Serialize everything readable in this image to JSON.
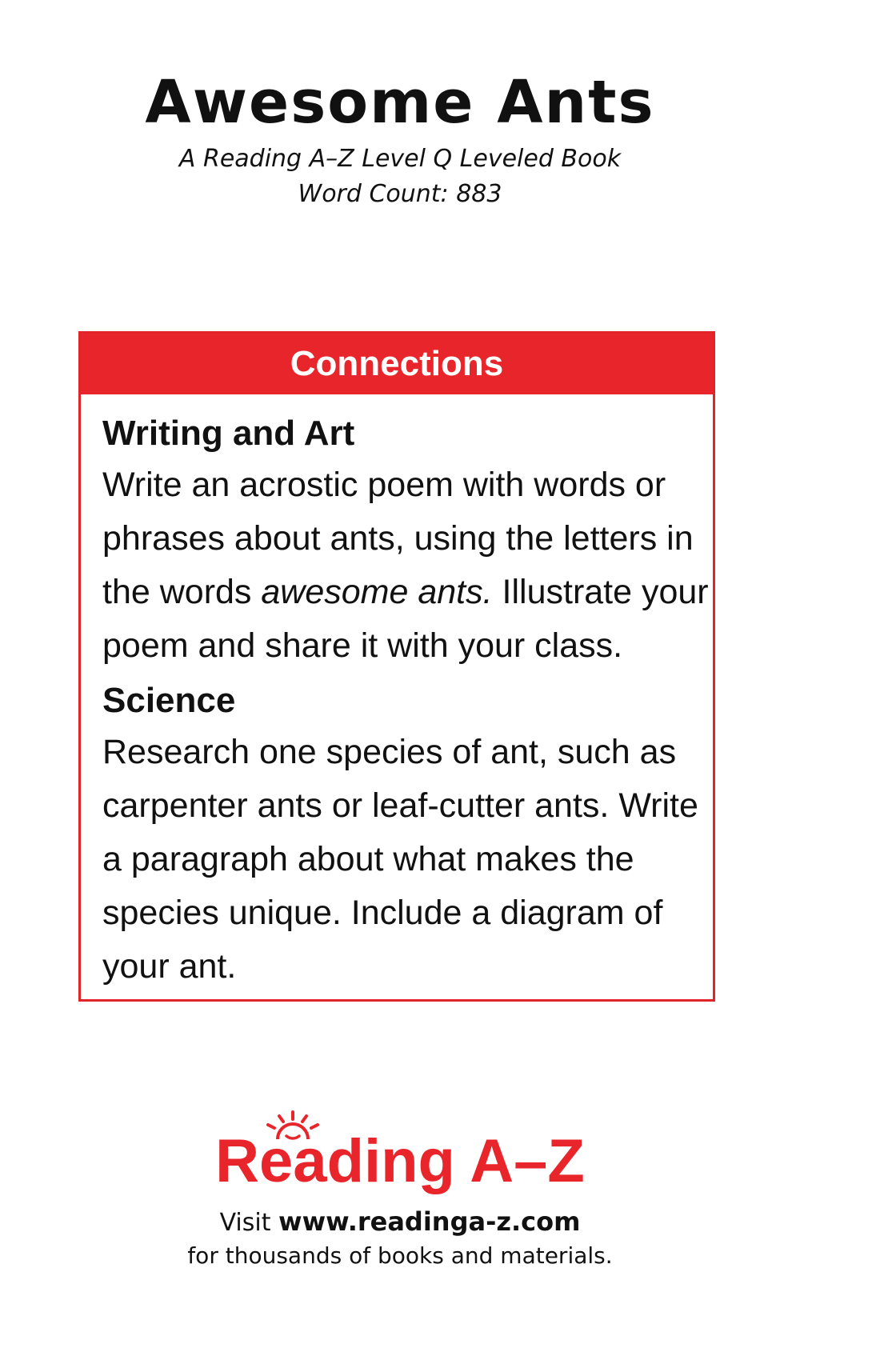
{
  "header": {
    "title": "Awesome Ants",
    "subtitle_line1": "A Reading A–Z Level Q Leveled Book",
    "subtitle_line2": "Word Count: 883"
  },
  "connections": {
    "heading": "Connections",
    "sections": [
      {
        "title": "Writing and Art",
        "text_before": "Write an acrostic poem with words or phrases about ants, using the letters in the words ",
        "text_italic": "awesome ants.",
        "text_after": " Illustrate your poem and share it with your class."
      },
      {
        "title": "Science",
        "text": "Research one species of ant, such as carpenter ants or leaf-cutter ants. Write a paragraph about what makes the species unique. Include a diagram of your ant."
      }
    ]
  },
  "footer": {
    "logo_text": "Reading A–Z",
    "visit_word": "Visit",
    "url": "www.readinga-z.com",
    "materials_text": "for thousands of books and materials."
  },
  "colors": {
    "brand_red": "#e8252b",
    "text": "#111111",
    "background": "#ffffff"
  },
  "icons": {
    "logo_mark": "sun-icon"
  }
}
